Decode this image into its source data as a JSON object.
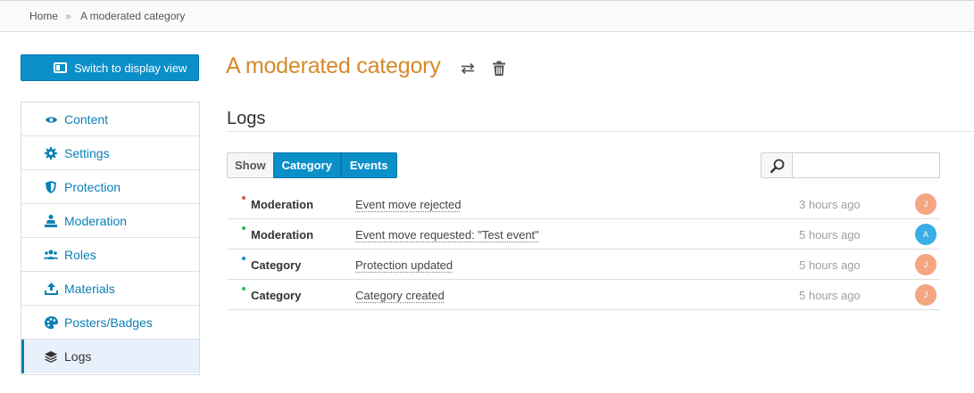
{
  "breadcrumb": {
    "home": "Home",
    "separator": "»",
    "current": "A moderated category"
  },
  "switch_button": {
    "label": "Switch to display view",
    "icon": "display-view-icon"
  },
  "sidebar": {
    "items": [
      {
        "label": "Content",
        "icon": "eye-icon",
        "active": false
      },
      {
        "label": "Settings",
        "icon": "gear-icon",
        "active": false
      },
      {
        "label": "Protection",
        "icon": "shield-icon",
        "active": false
      },
      {
        "label": "Moderation",
        "icon": "moderator-icon",
        "active": false
      },
      {
        "label": "Roles",
        "icon": "users-icon",
        "active": false
      },
      {
        "label": "Materials",
        "icon": "upload-icon",
        "active": false
      },
      {
        "label": "Posters/Badges",
        "icon": "palette-icon",
        "active": false
      },
      {
        "label": "Logs",
        "icon": "stack-icon",
        "active": true
      }
    ]
  },
  "header": {
    "title": "A moderated category",
    "title_color": "#d58a2a"
  },
  "logs": {
    "title": "Logs",
    "filter": {
      "show_label": "Show",
      "options": [
        "Category",
        "Events"
      ]
    },
    "search": {
      "placeholder": "",
      "value": ""
    },
    "entries": [
      {
        "type": "Moderation",
        "description": "Event move rejected",
        "time": "3 hours ago",
        "avatar": "J",
        "dot_color": "#d9534f",
        "avatar_color": "#f4a582"
      },
      {
        "type": "Moderation",
        "description": "Event move requested: \"Test event\"",
        "time": "5 hours ago",
        "avatar": "A",
        "dot_color": "#2db55d",
        "avatar_color": "#3aaee6"
      },
      {
        "type": "Category",
        "description": "Protection updated",
        "time": "5 hours ago",
        "avatar": "J",
        "dot_color": "#0a8fc9",
        "avatar_color": "#f4a582"
      },
      {
        "type": "Category",
        "description": "Category created",
        "time": "5 hours ago",
        "avatar": "J",
        "dot_color": "#2db55d",
        "avatar_color": "#f4a582"
      }
    ]
  },
  "colors": {
    "accent": "#0a8fc9",
    "link": "#0a7fb5"
  }
}
